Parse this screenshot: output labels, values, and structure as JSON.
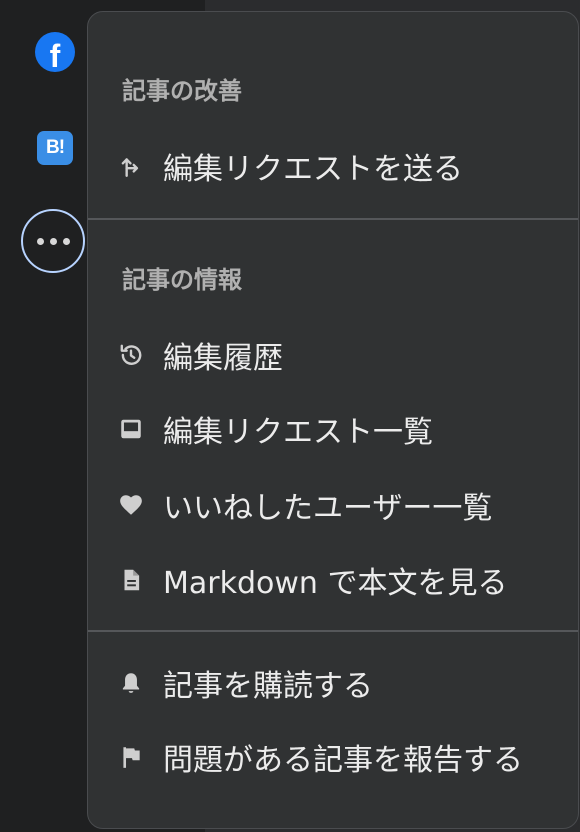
{
  "share": {
    "facebook_glyph": "f",
    "hatena_glyph": "B!"
  },
  "menu": {
    "sections": [
      {
        "title": "記事の改善",
        "items": [
          {
            "label": "編集リクエストを送る",
            "icon": "edit-request-arrow-icon"
          }
        ]
      },
      {
        "title": "記事の情報",
        "items": [
          {
            "label": "編集履歴",
            "icon": "history-icon"
          },
          {
            "label": "編集リクエスト一覧",
            "icon": "inbox-icon"
          },
          {
            "label": "いいねしたユーザー一覧",
            "icon": "heart-icon"
          },
          {
            "label": "Markdown で本文を見る",
            "icon": "document-icon"
          }
        ]
      },
      {
        "title": "",
        "items": [
          {
            "label": "記事を購読する",
            "icon": "bell-icon"
          },
          {
            "label": "問題がある記事を報告する",
            "icon": "flag-icon"
          }
        ]
      }
    ]
  },
  "colors": {
    "menu_bg": "#303233",
    "text": "#ececec",
    "section_title": "#b0b0b0",
    "facebook": "#1877f2",
    "hatena": "#3a8ee6",
    "focus_ring": "#b7d3ff"
  }
}
